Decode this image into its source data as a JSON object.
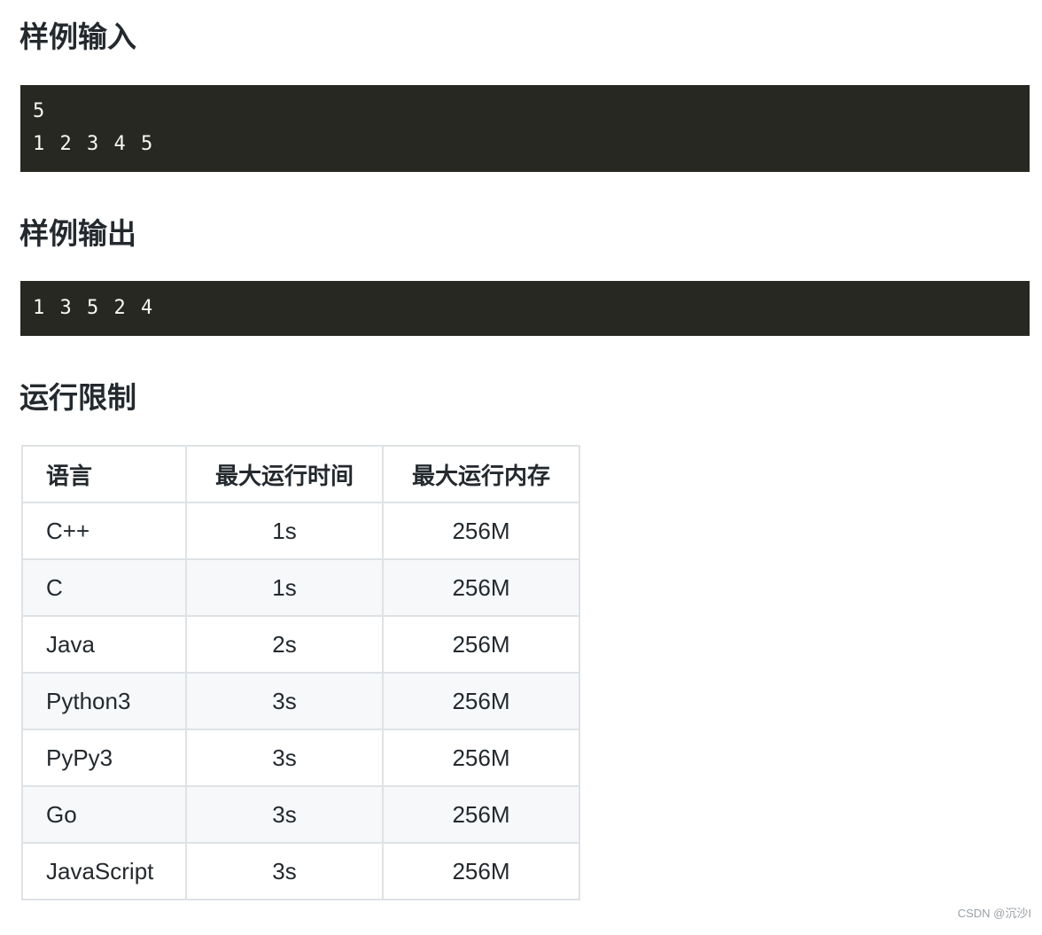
{
  "sample_input": {
    "heading": "样例输入",
    "lines": [
      "5",
      "1 2 3 4 5"
    ]
  },
  "sample_output": {
    "heading": "样例输出",
    "lines": [
      "1 3 5 2 4"
    ]
  },
  "run_limits": {
    "heading": "运行限制",
    "columns": [
      "语言",
      "最大运行时间",
      "最大运行内存"
    ],
    "rows": [
      [
        "C++",
        "1s",
        "256M"
      ],
      [
        "C",
        "1s",
        "256M"
      ],
      [
        "Java",
        "2s",
        "256M"
      ],
      [
        "Python3",
        "3s",
        "256M"
      ],
      [
        "PyPy3",
        "3s",
        "256M"
      ],
      [
        "Go",
        "3s",
        "256M"
      ],
      [
        "JavaScript",
        "3s",
        "256M"
      ]
    ]
  },
  "watermark": "CSDN @沉沙I"
}
